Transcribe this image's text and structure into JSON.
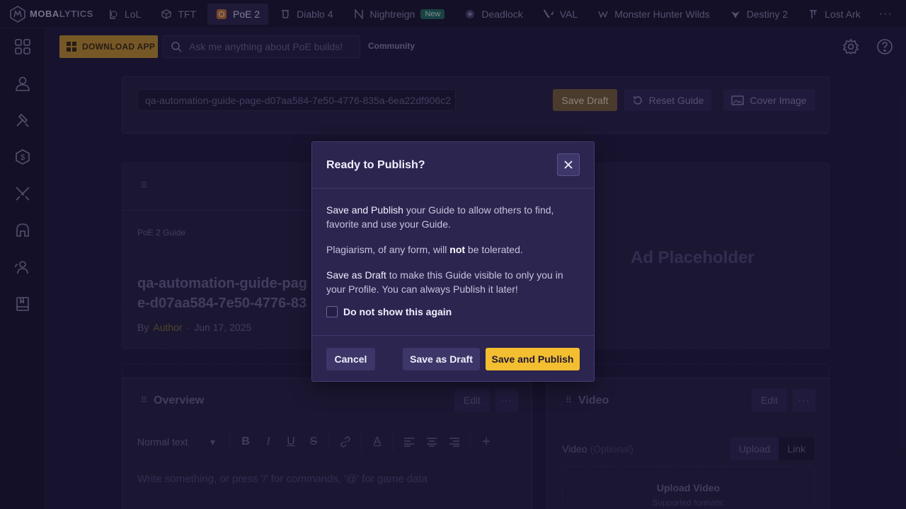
{
  "nav": {
    "logo_a": "MOBA",
    "logo_b": "LYTICS",
    "games": [
      {
        "label": "LoL",
        "icon": "lol-icon"
      },
      {
        "label": "TFT",
        "icon": "tft-icon"
      },
      {
        "label": "PoE 2",
        "icon": "poe2-icon",
        "active": true
      },
      {
        "label": "Diablo 4",
        "icon": "diablo-icon"
      },
      {
        "label": "Nightreign",
        "icon": "nightreign-icon",
        "badge": "New"
      },
      {
        "label": "Deadlock",
        "icon": "deadlock-icon"
      },
      {
        "label": "VAL",
        "icon": "valorant-icon"
      },
      {
        "label": "Monster Hunter Wilds",
        "icon": "monster-hunter-icon"
      },
      {
        "label": "Destiny 2",
        "icon": "destiny-icon"
      },
      {
        "label": "Lost Ark",
        "icon": "lost-ark-icon"
      }
    ],
    "more": "···"
  },
  "toolbar": {
    "download_label": "DOWNLOAD APP",
    "search_placeholder": "Ask me anything about PoE builds!",
    "community_label": "Community"
  },
  "guide_bar": {
    "slug": "qa-automation-guide-page-d07aa584-7e50-4776-835a-6ea22df906c2",
    "save_draft": "Save Draft",
    "reset_guide": "Reset Guide",
    "cover_image": "Cover Image"
  },
  "guide_card": {
    "type": "PoE 2 Guide",
    "title": "qa-automation-guide-page-d07aa584-7e50-4776-835a",
    "by": "By",
    "author": "Author",
    "dot": "·",
    "date": "Jun 17, 2025",
    "ad": "Ad Placeholder"
  },
  "overview": {
    "title": "Overview",
    "edit": "Edit",
    "text_style": "Normal text",
    "placeholder": "Write something, or press '/' for commands, '@' for game data"
  },
  "video": {
    "title": "Video",
    "edit": "Edit",
    "label": "Video",
    "optional": "(Optional)",
    "upload_tab": "Upload",
    "link_tab": "Link",
    "upload_title": "Upload Video",
    "upload_sub": "Supported formats:"
  },
  "modal": {
    "title": "Ready to Publish?",
    "p1_strong": "Save and Publish",
    "p1_rest": " your Guide to allow others to find, favorite and use your Guide.",
    "p2_a": "Plagiarism, of any form, will ",
    "p2_b": "not",
    "p2_c": " be tolerated.",
    "p3_strong": "Save as Draft",
    "p3_rest": " to make this Guide visible to only you in your Profile. You can always Publish it later!",
    "checkbox_label": "Do not show this again",
    "cancel": "Cancel",
    "save_draft": "Save as Draft",
    "publish": "Save and Publish"
  },
  "colors": {
    "background": "#1d1938",
    "accent": "#f3be30",
    "modal": "#2b2550"
  }
}
